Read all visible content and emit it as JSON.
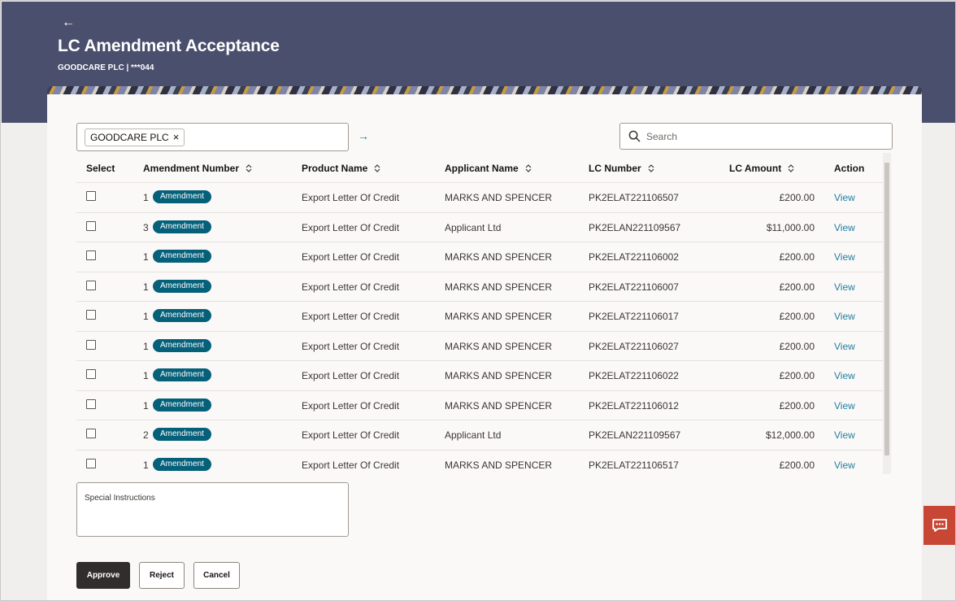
{
  "header": {
    "back_icon": "back-arrow-icon",
    "title": "LC Amendment Acceptance",
    "subtitle": "GOODCARE PLC | ***044"
  },
  "filter": {
    "chip_label": "GOODCARE PLC",
    "chip_remove": "×",
    "go_icon": "arrow-right-icon"
  },
  "search": {
    "placeholder": "Search",
    "value": ""
  },
  "table": {
    "columns": {
      "select": "Select",
      "amendment_number": "Amendment Number",
      "product_name": "Product Name",
      "applicant_name": "Applicant Name",
      "lc_number": "LC Number",
      "lc_amount": "LC Amount",
      "action": "Action"
    },
    "rows": [
      {
        "amendment_number": "1",
        "badge": "Amendment",
        "product_name": "Export Letter Of Credit",
        "applicant_name": "MARKS AND SPENCER",
        "lc_number": "PK2ELAT221106507",
        "lc_amount": "£200.00",
        "action": "View",
        "selected": false
      },
      {
        "amendment_number": "3",
        "badge": "Amendment",
        "product_name": "Export Letter Of Credit",
        "applicant_name": "Applicant Ltd",
        "lc_number": "PK2ELAN221109567",
        "lc_amount": "$11,000.00",
        "action": "View",
        "selected": false
      },
      {
        "amendment_number": "1",
        "badge": "Amendment",
        "product_name": "Export Letter Of Credit",
        "applicant_name": "MARKS AND SPENCER",
        "lc_number": "PK2ELAT221106002",
        "lc_amount": "£200.00",
        "action": "View",
        "selected": false
      },
      {
        "amendment_number": "1",
        "badge": "Amendment",
        "product_name": "Export Letter Of Credit",
        "applicant_name": "MARKS AND SPENCER",
        "lc_number": "PK2ELAT221106007",
        "lc_amount": "£200.00",
        "action": "View",
        "selected": false
      },
      {
        "amendment_number": "1",
        "badge": "Amendment",
        "product_name": "Export Letter Of Credit",
        "applicant_name": "MARKS AND SPENCER",
        "lc_number": "PK2ELAT221106017",
        "lc_amount": "£200.00",
        "action": "View",
        "selected": false
      },
      {
        "amendment_number": "1",
        "badge": "Amendment",
        "product_name": "Export Letter Of Credit",
        "applicant_name": "MARKS AND SPENCER",
        "lc_number": "PK2ELAT221106027",
        "lc_amount": "£200.00",
        "action": "View",
        "selected": false
      },
      {
        "amendment_number": "1",
        "badge": "Amendment",
        "product_name": "Export Letter Of Credit",
        "applicant_name": "MARKS AND SPENCER",
        "lc_number": "PK2ELAT221106022",
        "lc_amount": "£200.00",
        "action": "View",
        "selected": false
      },
      {
        "amendment_number": "1",
        "badge": "Amendment",
        "product_name": "Export Letter Of Credit",
        "applicant_name": "MARKS AND SPENCER",
        "lc_number": "PK2ELAT221106012",
        "lc_amount": "£200.00",
        "action": "View",
        "selected": false
      },
      {
        "amendment_number": "2",
        "badge": "Amendment",
        "product_name": "Export Letter Of Credit",
        "applicant_name": "Applicant Ltd",
        "lc_number": "PK2ELAN221109567",
        "lc_amount": "$12,000.00",
        "action": "View",
        "selected": false
      },
      {
        "amendment_number": "1",
        "badge": "Amendment",
        "product_name": "Export Letter Of Credit",
        "applicant_name": "MARKS AND SPENCER",
        "lc_number": "PK2ELAT221106517",
        "lc_amount": "£200.00",
        "action": "View",
        "selected": false
      }
    ]
  },
  "instructions": {
    "label": "Special Instructions",
    "value": ""
  },
  "actions": {
    "approve": "Approve",
    "reject": "Reject",
    "cancel": "Cancel"
  },
  "chat": {
    "icon": "chat-icon"
  },
  "colors": {
    "header_bg": "#4a4f6d",
    "badge_bg": "#05607a",
    "link": "#227e9e",
    "primary_button": "#312d2a",
    "chat_button": "#c74634"
  }
}
